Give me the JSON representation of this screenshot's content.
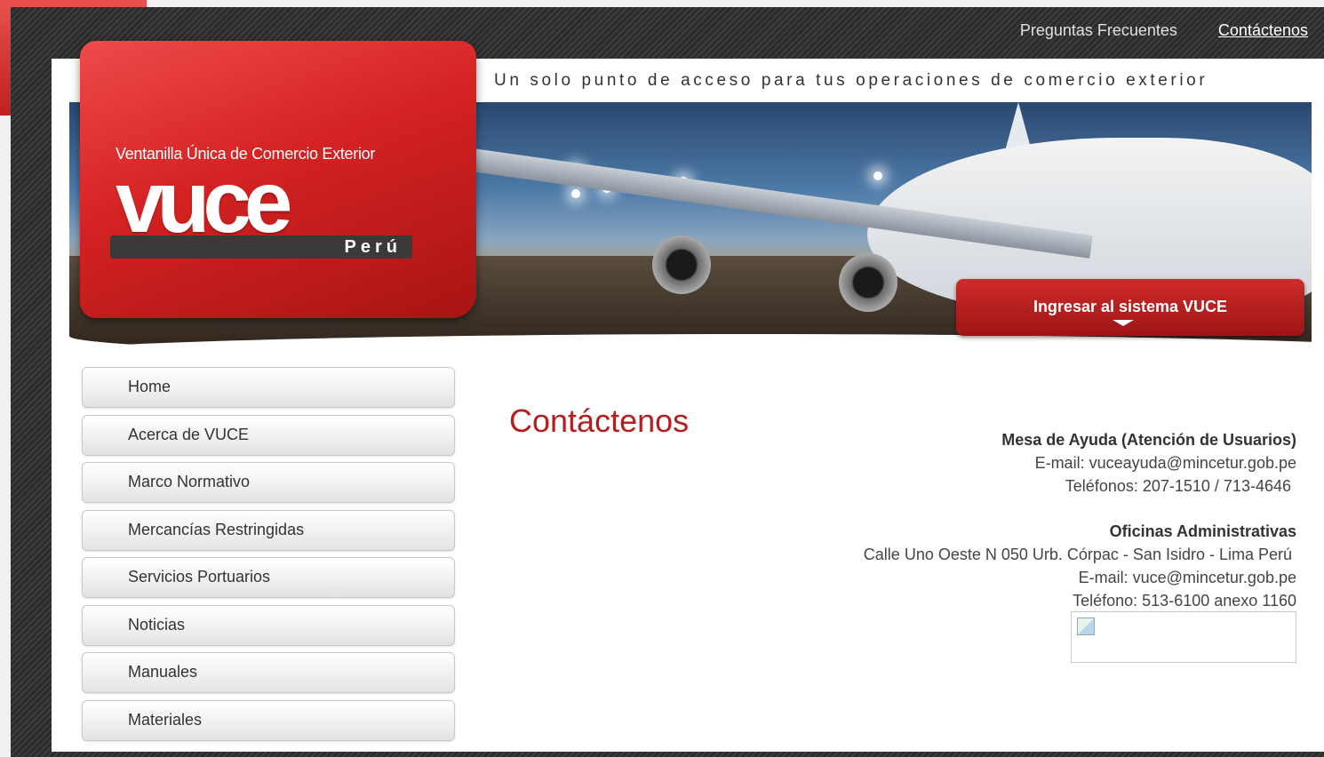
{
  "header": {
    "links": [
      {
        "label": "Preguntas Frecuentes"
      },
      {
        "label": "Contáctenos"
      }
    ],
    "tagline": "Un solo punto de acceso para tus operaciones de comercio exterior"
  },
  "logo": {
    "subtitle": "Ventanilla Única de Comercio Exterior",
    "wordmark": "vuce",
    "country": "Perú"
  },
  "banner": {
    "login_button": "Ingresar al sistema VUCE"
  },
  "sidebar": {
    "items": [
      {
        "label": "Home"
      },
      {
        "label": "Acerca de VUCE"
      },
      {
        "label": "Marco Normativo"
      },
      {
        "label": "Mercancías Restringidas"
      },
      {
        "label": "Servicios Portuarios"
      },
      {
        "label": "Noticias"
      },
      {
        "label": "Manuales"
      },
      {
        "label": "Materiales"
      }
    ]
  },
  "main": {
    "title": "Contáctenos",
    "helpdesk": {
      "heading": "Mesa de Ayuda (Atención de Usuarios)",
      "email": "E-mail: vuceayuda@mincetur.gob.pe",
      "phones": "Teléfonos: 207-1510 / 713-4646"
    },
    "offices": {
      "heading": "Oficinas Administrativas",
      "address": "Calle Uno Oeste N 050 Urb. Córpac - San Isidro - Lima Perú",
      "email": "E-mail: vuce@mincetur.gob.pe",
      "phone": "Teléfono: 513-6100 anexo 1160"
    }
  },
  "colors": {
    "brand_red": "#b41e1e",
    "frame_dark": "#2f2f2f"
  }
}
